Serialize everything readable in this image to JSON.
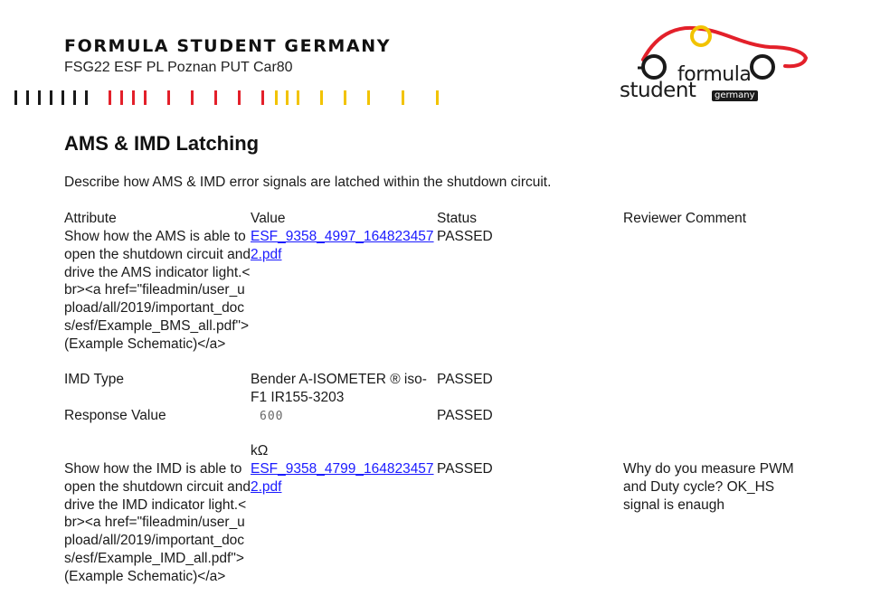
{
  "header": {
    "org_name": "FORMULA STUDENT GERMANY",
    "doc_subtitle": "FSG22 ESF PL Poznan PUT Car80",
    "logo": {
      "word1": "formula",
      "word2": "student",
      "tag": "germany",
      "colors": {
        "accent": "#e3202a",
        "yellow": "#f2c300",
        "dark": "#1a1a1a"
      }
    },
    "stripe_colors": [
      "#1a1a1a",
      "#e3202a",
      "#f2c300"
    ]
  },
  "section": {
    "title": "AMS & IMD Latching",
    "description": "Describe how AMS & IMD error signals are latched within the shutdown circuit."
  },
  "table": {
    "headers": {
      "attribute": "Attribute",
      "value": "Value",
      "status": "Status",
      "comment": "Reviewer Comment"
    },
    "rows": [
      {
        "attribute": "Show how the AMS is able to open the shutdown circuit and drive the AMS indicator light.<br><a href=\"fileadmin/user_upload/all/2019/important_docs/esf/Example_BMS_all.pdf\">(Example Schematic)</a>",
        "value_link": "ESF_9358_4997_1648234572.pdf",
        "status": "PASSED",
        "comment": ""
      },
      {
        "attribute": "IMD Type",
        "value": "Bender A-ISOMETER ® iso-F1 IR155-3203",
        "status": "PASSED",
        "comment": ""
      },
      {
        "attribute": "Response Value",
        "value": "600",
        "unit": "kΩ",
        "status": "PASSED",
        "comment": ""
      },
      {
        "attribute": "Show how the IMD is able to open the shutdown circuit and drive the IMD indicator light.<br><a href=\"fileadmin/user_upload/all/2019/important_docs/esf/Example_IMD_all.pdf\">(Example Schematic)</a>",
        "value_link": "ESF_9358_4799_1648234572.pdf",
        "status": "PASSED",
        "comment": "Why do you measure PWM and Duty cycle? OK_HS signal is enaugh"
      }
    ]
  }
}
